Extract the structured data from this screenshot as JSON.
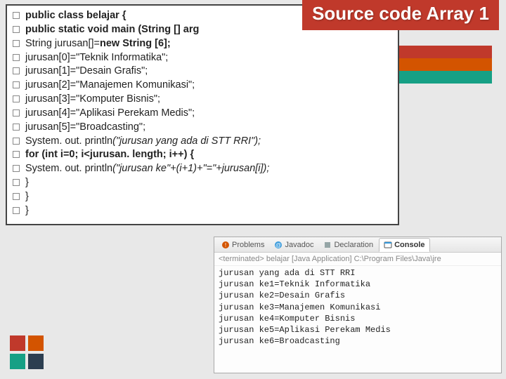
{
  "title": "Source code Array 1",
  "code_lines": [
    {
      "html": "public class belajar {",
      "bold": true
    },
    {
      "html": "public static void main (String [] arg",
      "bold": true
    },
    {
      "html": " String jurusan[]=<b>new String [6];</b>"
    },
    {
      "html": " jurusan[0]=\"Teknik Informatika\";"
    },
    {
      "html": " jurusan[1]=\"Desain Grafis\";"
    },
    {
      "html": " jurusan[2]=\"Manajemen Komunikasi\";"
    },
    {
      "html": " jurusan[3]=\"Komputer Bisnis\";"
    },
    {
      "html": " jurusan[4]=\"Aplikasi Perekam Medis\";"
    },
    {
      "html": " jurusan[5]=\"Broadcasting\";"
    },
    {
      "html": " System. out. println<i>(\"jurusan yang ada di STT RRI\");</i>"
    },
    {
      "html": " <b>for (int i=0; i&lt;jurusan. length; i++) {</b>"
    },
    {
      "html": "   System. out. println<i>(\"jurusan ke\"+(i+1)+\"=\"+jurusan[i]);</i>"
    },
    {
      "html": " }"
    },
    {
      "html": "}"
    },
    {
      "html": "}"
    }
  ],
  "console": {
    "tabs": {
      "problems": "Problems",
      "javadoc": "Javadoc",
      "declaration": "Declaration",
      "console": "Console"
    },
    "header": "<terminated> belajar [Java Application] C:\\Program Files\\Java\\jre",
    "output": [
      "jurusan yang ada di STT RRI",
      "jurusan ke1=Teknik Informatika",
      "jurusan ke2=Desain Grafis",
      "jurusan ke3=Manajemen Komunikasi",
      "jurusan ke4=Komputer Bisnis",
      "jurusan ke5=Aplikasi Perekam Medis",
      "jurusan ke6=Broadcasting"
    ]
  }
}
